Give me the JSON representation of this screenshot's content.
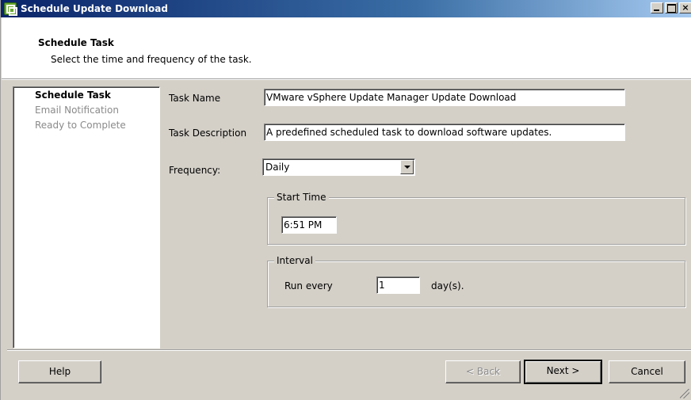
{
  "window": {
    "title": "Schedule Update Download",
    "controls": {
      "minimize": "_",
      "maximize": "□",
      "close": "×"
    }
  },
  "header": {
    "title": "Schedule Task",
    "subtitle": "Select the time and frequency of the task."
  },
  "nav": {
    "items": [
      {
        "label": "Schedule Task",
        "state": "active"
      },
      {
        "label": "Email Notification",
        "state": "inactive"
      },
      {
        "label": "Ready to Complete",
        "state": "inactive"
      }
    ]
  },
  "form": {
    "task_name_label": "Task Name",
    "task_name_value": "VMware vSphere Update Manager Update Download",
    "task_description_label": "Task Description",
    "task_description_value": "A predefined scheduled task to download software updates.",
    "frequency_label": "Frequency:",
    "frequency_value": "Daily",
    "start_time_group": "Start Time",
    "start_time_value": "6:51 PM",
    "interval_group": "Interval",
    "run_every_label": "Run every",
    "run_every_value": "1",
    "run_every_unit": "day(s)."
  },
  "buttons": {
    "help": "Help",
    "back": "< Back",
    "next": "Next >",
    "cancel": "Cancel"
  },
  "icons": {
    "title_icon": "vsphere-app-icon",
    "dropdown_icon": "chevron-down-icon",
    "resize_icon": "resize-grip-icon"
  }
}
